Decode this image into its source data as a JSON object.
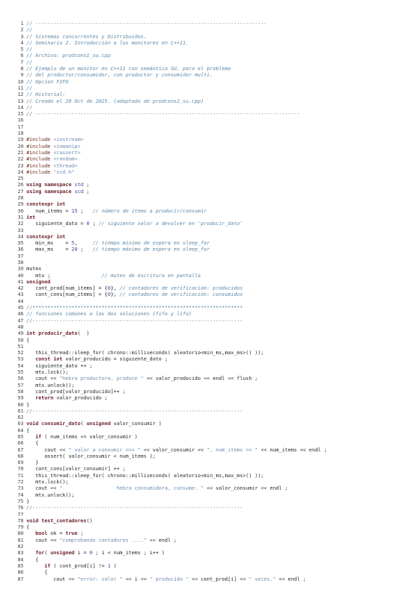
{
  "document": {
    "lines": [
      [
        {
          "t": "c",
          "v": "// -----------------------------------------------------------------------------"
        }
      ],
      [
        {
          "t": "c",
          "v": "//"
        }
      ],
      [
        {
          "t": "c",
          "v": "// Sistemas concurrentes y Distribuidos."
        }
      ],
      [
        {
          "t": "c",
          "v": "// Seminario 2. Introducción a los monitores en C++11."
        }
      ],
      [
        {
          "t": "c",
          "v": "//"
        }
      ],
      [
        {
          "t": "c",
          "v": "// Archivo: prodcons1_su.cpp"
        }
      ],
      [
        {
          "t": "c",
          "v": "//"
        }
      ],
      [
        {
          "t": "c",
          "v": "// Ejemplo de un monitor en C++11 con semántica SU, para el problema"
        }
      ],
      [
        {
          "t": "c",
          "v": "// del productor/consumidor, con productor y consumidor multi."
        }
      ],
      [
        {
          "t": "c",
          "v": "// Opcion FIFO"
        }
      ],
      [
        {
          "t": "c",
          "v": "//"
        }
      ],
      [
        {
          "t": "c",
          "v": "// Historial:"
        }
      ],
      [
        {
          "t": "c",
          "v": "// Creado el 29 Oct de 2025. (adaptado de prodcons2_su.cpp)"
        }
      ],
      [
        {
          "t": "c",
          "v": "//"
        }
      ],
      [
        {
          "t": "c",
          "v": "// ----------------------------------------------------------------------------------------"
        }
      ],
      [],
      [],
      [],
      [
        {
          "t": "p",
          "v": "#include "
        },
        {
          "t": "s",
          "v": "<iostream>"
        }
      ],
      [
        {
          "t": "p",
          "v": "#include "
        },
        {
          "t": "s",
          "v": "<iomanip>"
        }
      ],
      [
        {
          "t": "p",
          "v": "#include "
        },
        {
          "t": "s",
          "v": "<cassert>"
        }
      ],
      [
        {
          "t": "p",
          "v": "#include "
        },
        {
          "t": "s",
          "v": "<random>"
        }
      ],
      [
        {
          "t": "p",
          "v": "#include "
        },
        {
          "t": "s",
          "v": "<thread>"
        }
      ],
      [
        {
          "t": "p",
          "v": "#include "
        },
        {
          "t": "s",
          "v": "\"scd.h\""
        }
      ],
      [],
      [
        {
          "t": "k",
          "v": "using namespace"
        },
        {
          "t": "t",
          "v": " "
        },
        {
          "t": "n",
          "v": "std"
        },
        {
          "t": "t",
          "v": " ;"
        }
      ],
      [
        {
          "t": "k",
          "v": "using namespace"
        },
        {
          "t": "t",
          "v": " "
        },
        {
          "t": "n",
          "v": "scd"
        },
        {
          "t": "t",
          "v": " ;"
        }
      ],
      [],
      [
        {
          "t": "k",
          "v": "constexpr int"
        }
      ],
      [
        {
          "t": "t",
          "v": "   num_items = "
        },
        {
          "t": "n",
          "v": "15"
        },
        {
          "t": "t",
          "v": " ;   "
        },
        {
          "t": "c",
          "v": "// número de items a producir/consumir"
        }
      ],
      [
        {
          "t": "k",
          "v": "int"
        }
      ],
      [
        {
          "t": "t",
          "v": "   siguiente_dato = "
        },
        {
          "t": "n",
          "v": "0"
        },
        {
          "t": "t",
          "v": " ; "
        },
        {
          "t": "c",
          "v": "// siguiente valor a devolver en 'producir_dato'"
        }
      ],
      [],
      [
        {
          "t": "k",
          "v": "constexpr int"
        }
      ],
      [
        {
          "t": "t",
          "v": "   min_ms    = "
        },
        {
          "t": "n",
          "v": "5"
        },
        {
          "t": "t",
          "v": ",     "
        },
        {
          "t": "c",
          "v": "// tiempo minimo de espera en sleep_for"
        }
      ],
      [
        {
          "t": "t",
          "v": "   max_ms    = "
        },
        {
          "t": "n",
          "v": "20"
        },
        {
          "t": "t",
          "v": " ;   "
        },
        {
          "t": "c",
          "v": "// tiempo máximo de espera en sleep_for"
        }
      ],
      [],
      [],
      [
        {
          "t": "t",
          "v": "mutex"
        }
      ],
      [
        {
          "t": "t",
          "v": "   mtx ;                 "
        },
        {
          "t": "c",
          "v": "// mutex de escritura en pantalla"
        }
      ],
      [
        {
          "t": "k",
          "v": "unsigned"
        }
      ],
      [
        {
          "t": "t",
          "v": "   cont_prod[num_items] = {"
        },
        {
          "t": "n",
          "v": "0"
        },
        {
          "t": "t",
          "v": "}, "
        },
        {
          "t": "c",
          "v": "// contadores de verificación: producidos"
        }
      ],
      [
        {
          "t": "t",
          "v": "   cont_cons[num_items] = {"
        },
        {
          "t": "n",
          "v": "0"
        },
        {
          "t": "t",
          "v": "}; "
        },
        {
          "t": "c",
          "v": "// contadores de verificación: consumidos"
        }
      ],
      [],
      [
        {
          "t": "c",
          "v": "//**********************************************************************"
        }
      ],
      [
        {
          "t": "c",
          "v": "// funciones comunes a las dos soluciones (fifo y lifo)"
        }
      ],
      [
        {
          "t": "c",
          "v": "//----------------------------------------------------------------------"
        }
      ],
      [],
      [
        {
          "t": "k",
          "v": "int"
        },
        {
          "t": "t",
          "v": " "
        },
        {
          "t": "f",
          "v": "producir_dato"
        },
        {
          "t": "t",
          "v": "(  )"
        }
      ],
      [
        {
          "t": "t",
          "v": "{"
        }
      ],
      [],
      [
        {
          "t": "t",
          "v": "   this_thread::sleep_for( chrono::milliseconds( aleatorio<min_ms,max_ms>() ));"
        }
      ],
      [
        {
          "t": "t",
          "v": "   "
        },
        {
          "t": "k",
          "v": "const int"
        },
        {
          "t": "t",
          "v": " valor_producido = siguiente_dato ;"
        }
      ],
      [
        {
          "t": "t",
          "v": "   siguiente_dato ++ ;"
        }
      ],
      [
        {
          "t": "t",
          "v": "   mtx.lock();"
        }
      ],
      [
        {
          "t": "t",
          "v": "   cout << "
        },
        {
          "t": "s",
          "v": "\"hebra productora, produce \""
        },
        {
          "t": "t",
          "v": " << valor_producido << endl << flush ;"
        }
      ],
      [
        {
          "t": "t",
          "v": "   mtx.unlock();"
        }
      ],
      [
        {
          "t": "t",
          "v": "   cont_prod[valor_producido]++ ;"
        }
      ],
      [
        {
          "t": "t",
          "v": "   "
        },
        {
          "t": "k",
          "v": "return"
        },
        {
          "t": "t",
          "v": " valor_producido ;"
        }
      ],
      [
        {
          "t": "t",
          "v": "}"
        }
      ],
      [
        {
          "t": "c",
          "v": "//----------------------------------------------------------------------"
        }
      ],
      [],
      [
        {
          "t": "k",
          "v": "void"
        },
        {
          "t": "t",
          "v": " "
        },
        {
          "t": "f",
          "v": "consumir_dato"
        },
        {
          "t": "t",
          "v": "( "
        },
        {
          "t": "k",
          "v": "unsigned"
        },
        {
          "t": "t",
          "v": " valor_consumir )"
        }
      ],
      [
        {
          "t": "t",
          "v": "{"
        }
      ],
      [
        {
          "t": "t",
          "v": "   "
        },
        {
          "t": "k",
          "v": "if"
        },
        {
          "t": "t",
          "v": " ( num_items <= valor_consumir )"
        }
      ],
      [
        {
          "t": "t",
          "v": "   {"
        }
      ],
      [
        {
          "t": "t",
          "v": "      cout << "
        },
        {
          "t": "s",
          "v": "\" valor a consumir === \""
        },
        {
          "t": "t",
          "v": " << valor_consumir << "
        },
        {
          "t": "s",
          "v": "\", num_items == \""
        },
        {
          "t": "t",
          "v": " << num_items << endl ;"
        }
      ],
      [
        {
          "t": "t",
          "v": "      assert( valor_consumir < num_items );"
        }
      ],
      [
        {
          "t": "t",
          "v": "   }"
        }
      ],
      [
        {
          "t": "t",
          "v": "   cont_cons[valor_consumir] ++ ;"
        }
      ],
      [
        {
          "t": "t",
          "v": "   this_thread::sleep_for( chrono::milliseconds( aleatorio<min_ms,max_ms>() ));"
        }
      ],
      [
        {
          "t": "t",
          "v": "   mtx.lock();"
        }
      ],
      [
        {
          "t": "t",
          "v": "   cout << "
        },
        {
          "t": "s",
          "v": "\"                  hebra consumidora, consume: \""
        },
        {
          "t": "t",
          "v": " << valor_consumir << endl ;"
        }
      ],
      [
        {
          "t": "t",
          "v": "   mtx.unlock();"
        }
      ],
      [
        {
          "t": "t",
          "v": "}"
        }
      ],
      [
        {
          "t": "c",
          "v": "//----------------------------------------------------------------------"
        }
      ],
      [],
      [
        {
          "t": "k",
          "v": "void"
        },
        {
          "t": "t",
          "v": " "
        },
        {
          "t": "f",
          "v": "test_contadores"
        },
        {
          "t": "t",
          "v": "()"
        }
      ],
      [
        {
          "t": "t",
          "v": "{"
        }
      ],
      [
        {
          "t": "t",
          "v": "   "
        },
        {
          "t": "k",
          "v": "bool"
        },
        {
          "t": "t",
          "v": " ok = "
        },
        {
          "t": "k",
          "v": "true"
        },
        {
          "t": "t",
          "v": " ;"
        }
      ],
      [
        {
          "t": "t",
          "v": "   cout << "
        },
        {
          "t": "s",
          "v": "\"comprobando contadores ....\""
        },
        {
          "t": "t",
          "v": " << endl ;"
        }
      ],
      [],
      [
        {
          "t": "t",
          "v": "   "
        },
        {
          "t": "k",
          "v": "for"
        },
        {
          "t": "t",
          "v": "( "
        },
        {
          "t": "k",
          "v": "unsigned"
        },
        {
          "t": "t",
          "v": " i = "
        },
        {
          "t": "n",
          "v": "0"
        },
        {
          "t": "t",
          "v": " ; i < num_items ; i++ )"
        }
      ],
      [
        {
          "t": "t",
          "v": "   {"
        }
      ],
      [
        {
          "t": "t",
          "v": "      "
        },
        {
          "t": "k",
          "v": "if"
        },
        {
          "t": "t",
          "v": " ( cont_prod[i] != "
        },
        {
          "t": "n",
          "v": "1"
        },
        {
          "t": "t",
          "v": " )"
        }
      ],
      [
        {
          "t": "t",
          "v": "      {"
        }
      ],
      [
        {
          "t": "t",
          "v": "         cout << "
        },
        {
          "t": "s",
          "v": "\"error: valor \""
        },
        {
          "t": "t",
          "v": " << i << "
        },
        {
          "t": "s",
          "v": "\" producido \""
        },
        {
          "t": "t",
          "v": " << cont_prod[i] << "
        },
        {
          "t": "s",
          "v": "\" veces.\""
        },
        {
          "t": "t",
          "v": " << endl ;"
        }
      ]
    ]
  }
}
